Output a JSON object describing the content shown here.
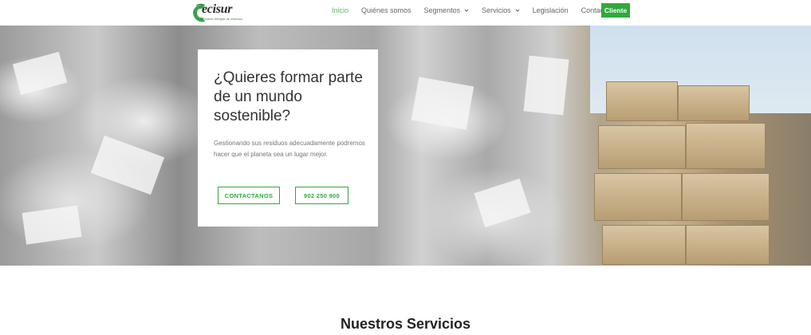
{
  "brand": {
    "name": "ecisur",
    "tagline": "Gestión Integral de residuos",
    "accent": "#2eaa3c",
    "active_color": "#5cb85c"
  },
  "nav": {
    "items": [
      {
        "label": "Inicio",
        "active": true
      },
      {
        "label": "Quiénes somos"
      },
      {
        "label": "Segmentos",
        "dropdown": true
      },
      {
        "label": "Servicios",
        "dropdown": true
      },
      {
        "label": "Legislación"
      },
      {
        "label": "Contacto"
      }
    ],
    "cta_label": "Cliente"
  },
  "hero": {
    "title": "¿Quieres formar parte de un mundo sostenible?",
    "text": "Gestionando sus residuos adecuadamente podremos hacer que el planeta sea un lugar mejor.",
    "button_contact": "CONTACTANOS",
    "button_phone": "902 250 900"
  },
  "services": {
    "title": "Nuestros Servicios"
  }
}
